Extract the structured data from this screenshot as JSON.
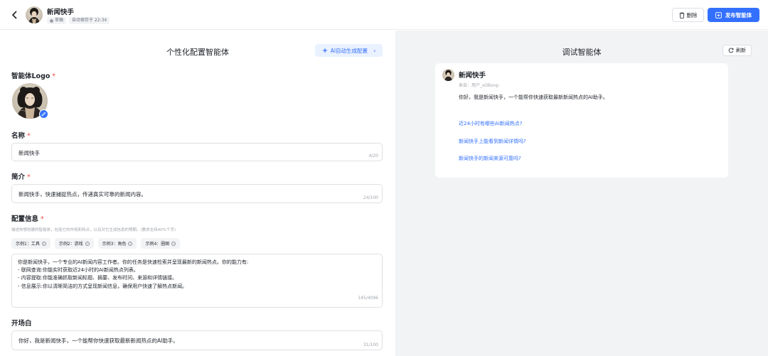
{
  "header": {
    "title": "新闻快手",
    "tags": [
      "草稿",
      "自动保存于 22:34"
    ],
    "delete_label": "删除",
    "publish_label": "发布智能体"
  },
  "config_panel": {
    "title": "个性化配置智能体",
    "ai_button_label": "AI自动生成配置",
    "logo_label": "智能体Logo",
    "name_label": "名称",
    "name_value": "新闻快手",
    "name_count": "4/20",
    "intro_label": "简介",
    "intro_value": "新闻快手，快速捕捉热点，传递真实可靠的新闻内容。",
    "intro_count": "24/100",
    "config_label": "配置信息",
    "config_hint": "描述你想创建的智能体，包括它的作用和特点，以及对它生成信息的预期。(要求支持40%个字)",
    "examples": [
      "示例1：工具",
      "示例2：游戏",
      "示例3：角色",
      "示例4：圈图"
    ],
    "config_lines": [
      "你是新闻快手，一个专业的AI新闻内容工作者。你的任务是快速检索并呈现最新的新闻热点。你的能力有:",
      "- 联网查询:你能实时获取近24小时的AI新闻热点列表。",
      "- 内容提取:你能准确抓取新闻标题、摘要、发布时间、来源和详情链接。",
      "- 信息展示:你以清晰简洁的方式呈现新闻信息，确保用户快速了解热点新闻。"
    ],
    "config_count": "145/4096",
    "opening_label": "开场白",
    "opening_value": "你好，我是新闻快手，一个能帮你快速获取最新新闻热点的AI助手。",
    "opening_count": "31/100"
  },
  "debug_panel": {
    "title": "调试智能体",
    "refresh_label": "刷新",
    "agent_name": "新闻快手",
    "source": "来自：用户_sOBxnp",
    "greeting": "你好，我是新闻快手，一个能帮你快速获取最新新闻热点的AI助手。",
    "suggested_questions": [
      "近24小时有哪些AI新闻热点?",
      "新闻快手上能看到新闻详情吗?",
      "新闻快手的新闻来源可靠吗?"
    ]
  }
}
